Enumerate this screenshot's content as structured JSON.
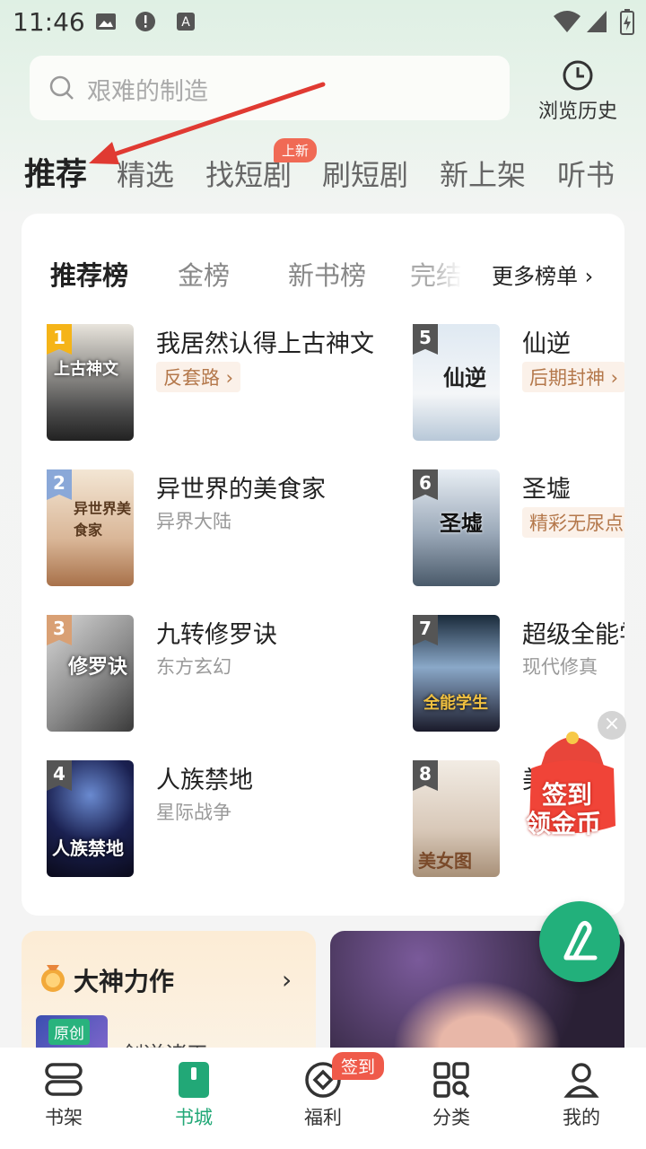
{
  "status": {
    "time": "11:46"
  },
  "search": {
    "placeholder": "艰难的制造",
    "history_label": "浏览历史"
  },
  "tabs": [
    {
      "label": "推荐",
      "active": true
    },
    {
      "label": "精选"
    },
    {
      "label": "找短剧",
      "badge": "上新"
    },
    {
      "label": "刷短剧"
    },
    {
      "label": "新上架"
    },
    {
      "label": "听书"
    }
  ],
  "rank": {
    "tabs": [
      "推荐榜",
      "金榜",
      "新书榜",
      "完结"
    ],
    "more": "更多榜单",
    "books": [
      {
        "num": "1",
        "title": "我居然认得上古神文",
        "tag": "反套路",
        "tag_style": "pill",
        "cover_text": "上古神文"
      },
      {
        "num": "2",
        "title": "异世界的美食家",
        "tag": "异界大陆",
        "cover_text": "异世界美食家"
      },
      {
        "num": "3",
        "title": "九转修罗诀",
        "tag": "东方玄幻",
        "cover_text": "修罗诀"
      },
      {
        "num": "4",
        "title": "人族禁地",
        "tag": "星际战争",
        "cover_text": "人族禁地"
      },
      {
        "num": "5",
        "title": "仙逆",
        "tag": "后期封神",
        "tag_style": "pill",
        "cover_text": "仙逆"
      },
      {
        "num": "6",
        "title": "圣墟",
        "tag": "精彩无尿点",
        "tag_style": "pill",
        "cover_text": "圣墟"
      },
      {
        "num": "7",
        "title": "超级全能学",
        "tag": "现代修真",
        "cover_text": "全能学生"
      },
      {
        "num": "8",
        "title": "美",
        "tag": "",
        "cover_text": "美女图"
      }
    ]
  },
  "god": {
    "title": "大神力作",
    "badge": "原创",
    "book_title": "剑逆诸天"
  },
  "float": {
    "checkin_line1": "签到",
    "checkin_line2": "领金币",
    "close": "×"
  },
  "nav": [
    {
      "label": "书架"
    },
    {
      "label": "书城",
      "active": true
    },
    {
      "label": "福利",
      "badge": "签到"
    },
    {
      "label": "分类"
    },
    {
      "label": "我的"
    }
  ],
  "colors": {
    "accent": "#22b07b",
    "badge": "#f06a55"
  }
}
